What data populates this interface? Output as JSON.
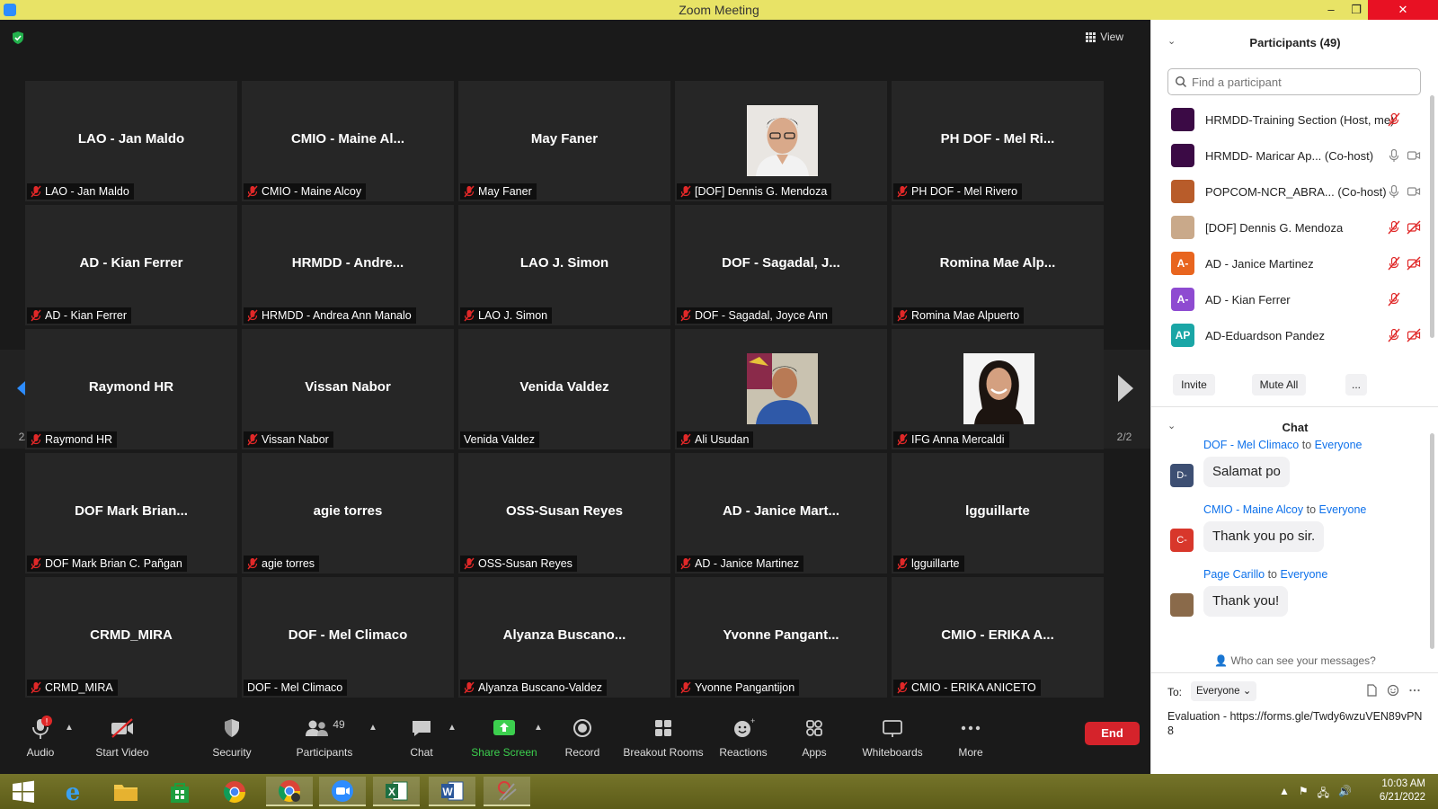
{
  "window": {
    "title": "Zoom Meeting",
    "minimize": "–",
    "restore": "❐",
    "close": "✕"
  },
  "meeting": {
    "view_label": "View",
    "page_indicator_left": "2/2",
    "page_indicator_right": "2/2",
    "tiles": [
      {
        "big": "LAO - Jan Maldo",
        "label": "LAO - Jan Maldo",
        "muted": true,
        "photo": null
      },
      {
        "big": "CMIO  - Maine Al...",
        "label": "CMIO - Maine Alcoy",
        "muted": true,
        "photo": null
      },
      {
        "big": "May Faner",
        "label": "May Faner",
        "muted": true,
        "photo": null
      },
      {
        "big": "",
        "label": "[DOF] Dennis G. Mendoza",
        "muted": true,
        "photo": "man-glasses"
      },
      {
        "big": "PH DOF - Mel Ri...",
        "label": "PH DOF - Mel Rivero",
        "muted": true,
        "photo": null
      },
      {
        "big": "AD - Kian Ferrer",
        "label": "AD - Kian Ferrer",
        "muted": true,
        "photo": null
      },
      {
        "big": "HRMDD  - Andre...",
        "label": "HRMDD - Andrea Ann Manalo",
        "muted": true,
        "photo": null
      },
      {
        "big": "LAO J. Simon",
        "label": "LAO J. Simon",
        "muted": true,
        "photo": null
      },
      {
        "big": "DOF - Sagadal, J...",
        "label": "DOF - Sagadal, Joyce Ann",
        "muted": true,
        "photo": null
      },
      {
        "big": "Romina  Mae  Alp...",
        "label": "Romina Mae Alpuerto",
        "muted": true,
        "photo": null
      },
      {
        "big": "Raymond HR",
        "label": "Raymond HR",
        "muted": true,
        "photo": null
      },
      {
        "big": "Vissan Nabor",
        "label": "Vissan Nabor",
        "muted": true,
        "photo": null
      },
      {
        "big": "Venida Valdez",
        "label": "Venida Valdez",
        "muted": false,
        "photo": null
      },
      {
        "big": "",
        "label": "Ali Usudan",
        "muted": true,
        "photo": "man-blue"
      },
      {
        "big": "",
        "label": "IFG Anna Mercaldi",
        "muted": true,
        "photo": "woman"
      },
      {
        "big": "DOF Mark Brian...",
        "label": "DOF Mark Brian C. Pañgan",
        "muted": true,
        "photo": null
      },
      {
        "big": "agie torres",
        "label": "agie torres",
        "muted": true,
        "photo": null
      },
      {
        "big": "OSS-Susan Reyes",
        "label": "OSS-Susan Reyes",
        "muted": true,
        "photo": null
      },
      {
        "big": "AD  - Janice Mart...",
        "label": "AD - Janice Martinez",
        "muted": true,
        "photo": null
      },
      {
        "big": "lgguillarte",
        "label": "lgguillarte",
        "muted": true,
        "photo": null
      },
      {
        "big": "CRMD_MIRA",
        "label": "CRMD_MIRA",
        "muted": true,
        "photo": null
      },
      {
        "big": "DOF - Mel Climaco",
        "label": "DOF - Mel Climaco",
        "muted": false,
        "photo": null
      },
      {
        "big": "Alyanza  Buscano...",
        "label": "Alyanza Buscano-Valdez",
        "muted": true,
        "photo": null
      },
      {
        "big": "Yvonne  Pangant...",
        "label": "Yvonne Pangantijon",
        "muted": true,
        "photo": null
      },
      {
        "big": "CMIO  -  ERIKA  A...",
        "label": "CMIO - ERIKA ANICETO",
        "muted": true,
        "photo": null
      }
    ]
  },
  "toolbar": {
    "audio": "Audio",
    "audio_badge": "!",
    "start_video": "Start Video",
    "security": "Security",
    "participants": "Participants",
    "participants_count": "49",
    "chat": "Chat",
    "share_screen": "Share Screen",
    "record": "Record",
    "breakout_rooms": "Breakout Rooms",
    "reactions": "Reactions",
    "apps": "Apps",
    "whiteboards": "Whiteboards",
    "more": "More",
    "end": "End"
  },
  "participants_panel": {
    "title": "Participants (49)",
    "search_placeholder": "Find a participant",
    "rows": [
      {
        "initials": "",
        "avatar_color": "#3b0a45",
        "name": "HRMDD-Training Section (Host, me)",
        "mic": "muted",
        "video": "none"
      },
      {
        "initials": "",
        "avatar_color": "#3b0a45",
        "name": "HRMDD- Maricar Ap...  (Co-host)",
        "mic": "on",
        "video": "on"
      },
      {
        "initials": "",
        "avatar_color": "#b85c2a",
        "name": "POPCOM-NCR_ABRA...  (Co-host)",
        "mic": "on",
        "video": "on"
      },
      {
        "initials": "",
        "avatar_color": "#c9a98a",
        "name": "[DOF] Dennis G. Mendoza",
        "mic": "muted",
        "video": "off"
      },
      {
        "initials": "A-",
        "avatar_color": "#e8651f",
        "name": "AD - Janice Martinez",
        "mic": "muted",
        "video": "off"
      },
      {
        "initials": "A-",
        "avatar_color": "#8e4bd1",
        "name": "AD - Kian Ferrer",
        "mic": "muted",
        "video": "none"
      },
      {
        "initials": "AP",
        "avatar_color": "#1aa6a6",
        "name": "AD-Eduardson Pandez",
        "mic": "muted",
        "video": "off"
      }
    ],
    "invite": "Invite",
    "mute_all": "Mute All",
    "more": "..."
  },
  "chat_panel": {
    "title": "Chat",
    "messages": [
      {
        "from": "DOF - Mel Climaco",
        "to_word": "to",
        "to": "Everyone",
        "initials": "D-",
        "avatar_color": "#3d4f73",
        "text": "Salamat po"
      },
      {
        "from": "CMIO - Maine Alcoy",
        "to_word": "to",
        "to": "Everyone",
        "initials": "C-",
        "avatar_color": "#d8372b",
        "text": "Thank you po sir."
      },
      {
        "from": "Page Carillo",
        "to_word": "to",
        "to": "Everyone",
        "initials": "",
        "avatar_color": "#8a6a4a",
        "text": "Thank you!"
      }
    ],
    "who_can_see": "Who can see your messages?",
    "to_label": "To:",
    "to_value": "Everyone",
    "draft_text": "Evaluation - https://forms.gle/Twdy6wzuVEN89vPN8"
  },
  "taskbar": {
    "time": "10:03 AM",
    "date": "6/21/2022"
  },
  "colors": {
    "titlebar": "#e8e366",
    "accent_blue": "#0e71eb",
    "share_green": "#3ccf4e",
    "end_red": "#d5232b",
    "mute_red": "#e02828"
  }
}
